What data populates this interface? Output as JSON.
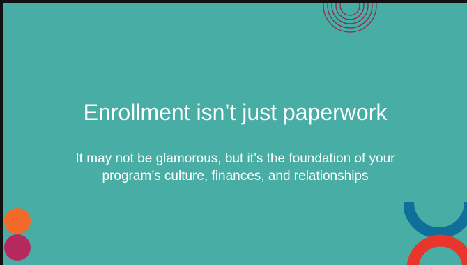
{
  "slide": {
    "title": "Enrollment isn’t just paperwork",
    "subtitle_lines": [
      "It may not be glamorous, but it’s the foundation of your",
      "program’s culture, finances, and relationships"
    ]
  },
  "colors": {
    "background": "#48ada5",
    "border": "#111111",
    "text": "#ffffff",
    "rings": "#8c2a48",
    "orange_dot": "#f26a2a",
    "magenta_dot": "#b52a5e",
    "blue_arc": "#0e6f9a",
    "red_arc": "#e8362d"
  },
  "decorations": {
    "top_ring_icon": "concentric-rings",
    "left_dots_icon": "stacked-circles",
    "right_arcs_icon": "stacked-arcs"
  }
}
